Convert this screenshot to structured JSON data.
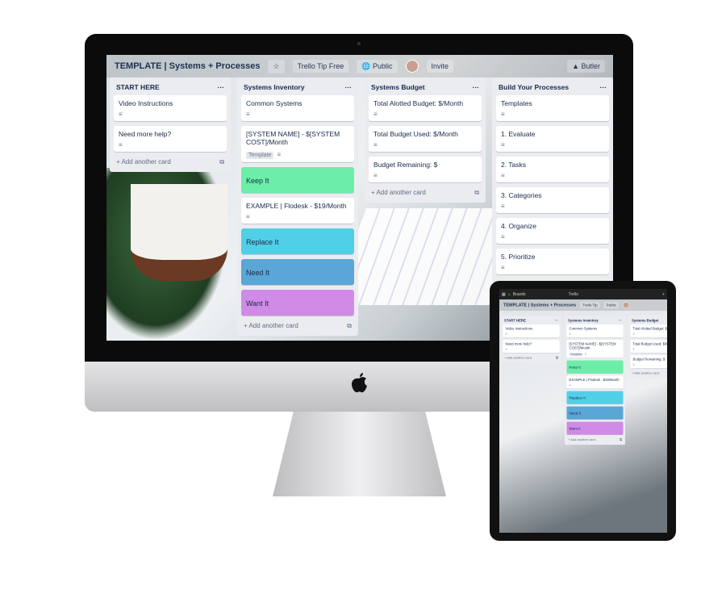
{
  "board": {
    "title": "TEMPLATE | Systems + Processes",
    "team": "Trello Tip",
    "plan": "Free",
    "visibility": "Public",
    "invite": "Invite",
    "butler": "Butler",
    "add_card": "Add another card",
    "menu": "···",
    "app": "Trello",
    "boards": "Boards"
  },
  "lists": [
    {
      "title": "START HERE",
      "cards": [
        {
          "text": "Video Instructions",
          "desc": true
        },
        {
          "text": "Need more help?",
          "desc": true
        }
      ],
      "add": true
    },
    {
      "title": "Systems Inventory",
      "cards": [
        {
          "text": "Common Systems",
          "desc": true
        },
        {
          "text": "[SYSTEM NAME] - $[SYSTEM COST]/Month",
          "template": "Template",
          "desc": true
        },
        {
          "text": "Keep It",
          "color": "#6ceea8"
        },
        {
          "text": "EXAMPLE | Flodesk - $19/Month",
          "desc": true
        },
        {
          "text": "Replace It",
          "color": "#51cfe6"
        },
        {
          "text": "Need It",
          "color": "#5aa6d6"
        },
        {
          "text": "Want It",
          "color": "#d08be6"
        }
      ],
      "add": true
    },
    {
      "title": "Systems Budget",
      "cards": [
        {
          "text": "Total Alotted Budget: $/Month",
          "desc": true
        },
        {
          "text": "Total Budget Used: $/Month",
          "desc": true
        },
        {
          "text": "Budget Remaining: $",
          "desc": true
        }
      ],
      "add": true
    },
    {
      "title": "Build Your Processes",
      "cards": [
        {
          "text": "Templates",
          "desc": true
        },
        {
          "text": "1. Evaluate",
          "desc": true
        },
        {
          "text": "2. Tasks",
          "desc": true
        },
        {
          "text": "3. Categories",
          "desc": true
        },
        {
          "text": "4. Organize",
          "desc": true
        },
        {
          "text": "5. Prioritize",
          "desc": true
        }
      ],
      "add": false
    }
  ]
}
